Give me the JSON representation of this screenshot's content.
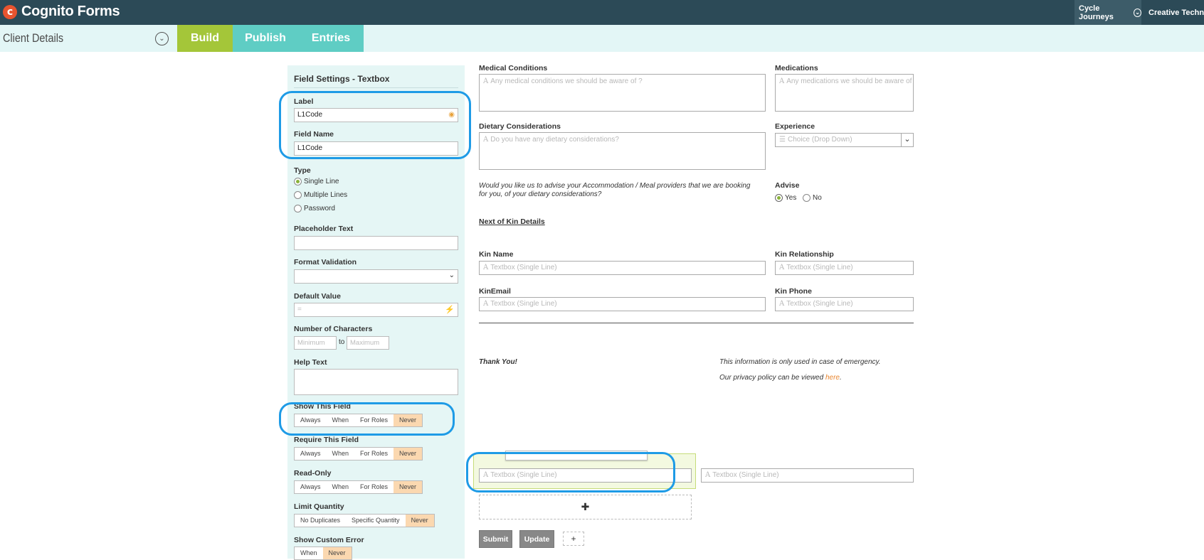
{
  "app": {
    "logo_text": "Cognito Forms",
    "org": "Cycle Journeys",
    "company": "Creative Technolog"
  },
  "form": {
    "title": "Client Details"
  },
  "tabs": [
    {
      "label": "Build"
    },
    {
      "label": "Publish"
    },
    {
      "label": "Entries"
    }
  ],
  "settings": {
    "header": "Field Settings - Textbox",
    "label_label": "Label",
    "label_value": "L1Code",
    "field_name_label": "Field Name",
    "field_name_value": "L1Code",
    "type_label": "Type",
    "type_options": [
      "Single Line",
      "Multiple Lines",
      "Password"
    ],
    "placeholder_label": "Placeholder Text",
    "format_label": "Format Validation",
    "default_label": "Default Value",
    "default_placeholder": "=",
    "chars_label": "Number of Characters",
    "chars_min": "Minimum",
    "chars_to": "to",
    "chars_max": "Maximum",
    "help_label": "Help Text",
    "show_label": "Show This Field",
    "require_label": "Require This Field",
    "readonly_label": "Read-Only",
    "visibility_options": [
      "Always",
      "When",
      "For Roles",
      "Never"
    ],
    "limit_label": "Limit Quantity",
    "limit_options": [
      "No Duplicates",
      "Specific Quantity",
      "Never"
    ],
    "error_label": "Show Custom Error",
    "error_options": [
      "When",
      "Never"
    ]
  },
  "fields": {
    "medical_label": "Medical Conditions",
    "medical_ph": "Any medical conditions we should be aware of ?",
    "medications_label": "Medications",
    "medications_ph": "Any medications we should be aware of ?",
    "dietary_label": "Dietary Considerations",
    "dietary_ph": "Do you have any dietary considerations?",
    "experience_label": "Experience",
    "experience_ph": "Choice (Drop Down)",
    "question": "Would you like us to advise your Accommodation / Meal providers that we are booking for you, of your dietary considerations?",
    "advise_label": "Advise",
    "advise_yes": "Yes",
    "advise_no": "No",
    "kin_heading": "Next of Kin Details",
    "kin_name_label": "Kin Name",
    "kin_rel_label": "Kin Relationship",
    "kin_email_label": "KinEmail",
    "kin_phone_label": "Kin Phone",
    "textbox_ph": "Textbox (Single Line)",
    "thanks": "Thank You!",
    "note1": "This information is only used in case of emergency.",
    "note2_pre": "Our privacy policy can be viewed ",
    "note2_link": "here",
    "note2_post": "."
  },
  "buttons": {
    "submit": "Submit",
    "update": "Update",
    "add": "+"
  }
}
